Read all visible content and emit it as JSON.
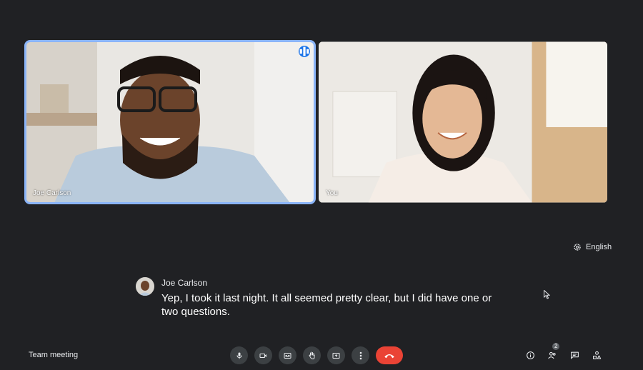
{
  "participants": [
    {
      "name": "Joe Carlson",
      "speaking": true
    },
    {
      "name": "You",
      "speaking": false
    }
  ],
  "captions": {
    "language": "English",
    "speaker": "Joe Carlson",
    "text": "Yep, I took it last night. It all seemed pretty clear, but I did have one or two questions."
  },
  "meeting": {
    "name": "Team meeting"
  },
  "controls": [
    "microphone-icon",
    "camera-icon",
    "captions-icon",
    "raise-hand-icon",
    "present-icon",
    "more-options-icon",
    "end-call-icon"
  ],
  "right_panel": {
    "people_count": "2"
  },
  "colors": {
    "background": "#202124",
    "accent": "#8ab4f8",
    "end_call": "#ea4335"
  }
}
